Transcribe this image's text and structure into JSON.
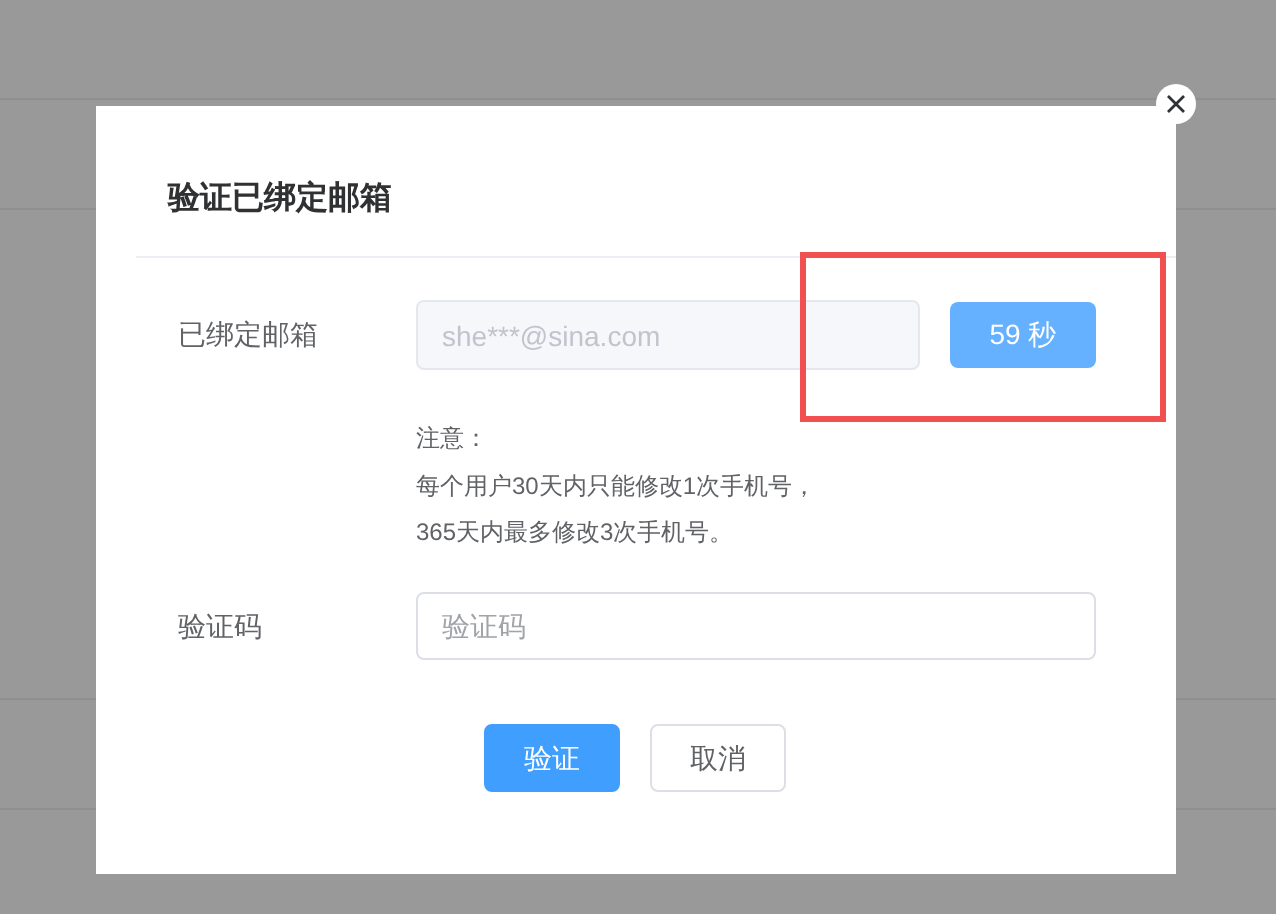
{
  "dialog": {
    "title": "验证已绑定邮箱",
    "email_row": {
      "label": "已绑定邮箱",
      "value": "she***@sina.com",
      "disabled": true,
      "countdown_button": {
        "label": "59 秒",
        "disabled": true,
        "highlighted": true
      }
    },
    "notes": [
      "注意：",
      "每个用户30天内只能修改1次手机号，",
      "365天内最多修改3次手机号。"
    ],
    "code_row": {
      "label": "验证码",
      "placeholder": "验证码"
    },
    "buttons": [
      {
        "label": "验证",
        "kind": "primary"
      },
      {
        "label": "取消",
        "kind": "default"
      }
    ]
  }
}
